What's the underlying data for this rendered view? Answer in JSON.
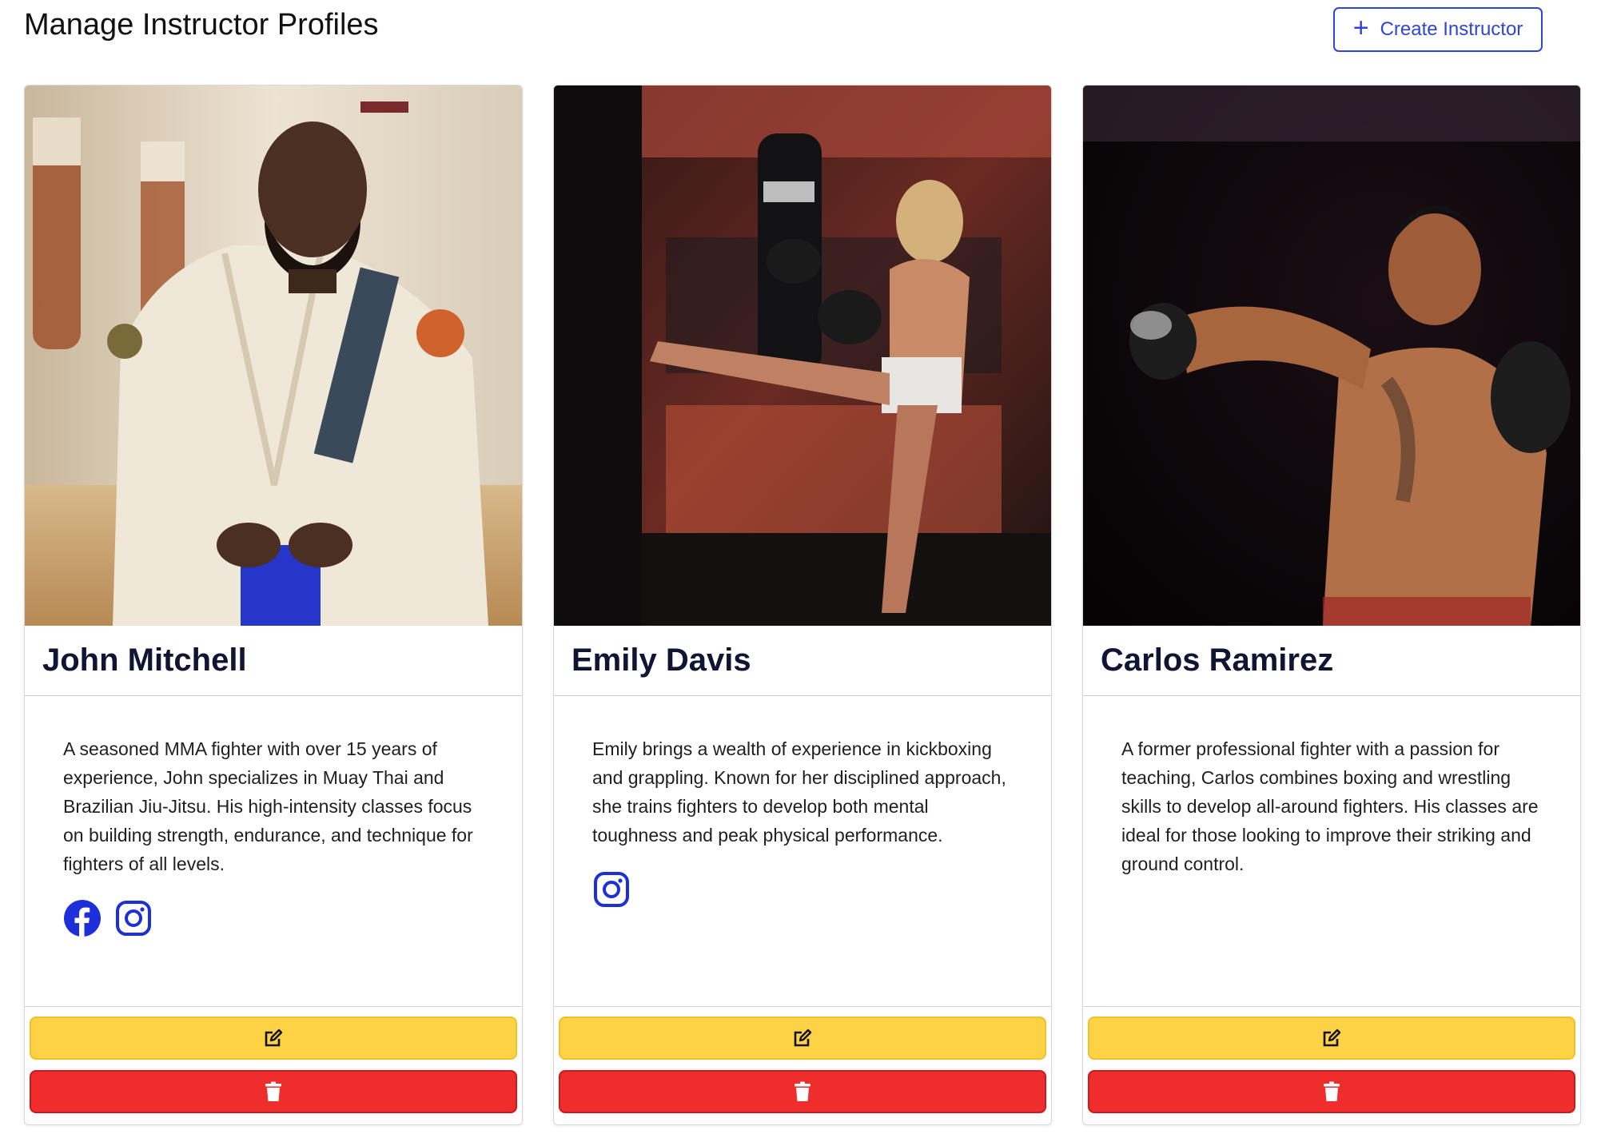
{
  "header": {
    "title": "Manage Instructor Profiles",
    "create_button_label": "Create Instructor"
  },
  "colors": {
    "primary": "#2f45d6",
    "edit": "#fdd245",
    "delete": "#ef2d2d",
    "name": "#0f1533"
  },
  "instructors": [
    {
      "name": "John Mitchell",
      "bio": "A seasoned MMA fighter with over 15 years of experience, John specializes in Muay Thai and Brazilian Jiu-Jitsu. His high-intensity classes focus on building strength, endurance, and technique for fighters of all levels.",
      "socials": [
        "facebook-icon",
        "instagram-icon"
      ]
    },
    {
      "name": "Emily Davis",
      "bio": "Emily brings a wealth of experience in kickboxing and grappling. Known for her disciplined approach, she trains fighters to develop both mental toughness and peak physical performance.",
      "socials": [
        "instagram-icon"
      ]
    },
    {
      "name": "Carlos Ramirez",
      "bio": "A former professional fighter with a passion for teaching, Carlos combines boxing and wrestling skills to develop all-around fighters. His classes are ideal for those looking to improve their striking and ground control.",
      "socials": []
    }
  ]
}
